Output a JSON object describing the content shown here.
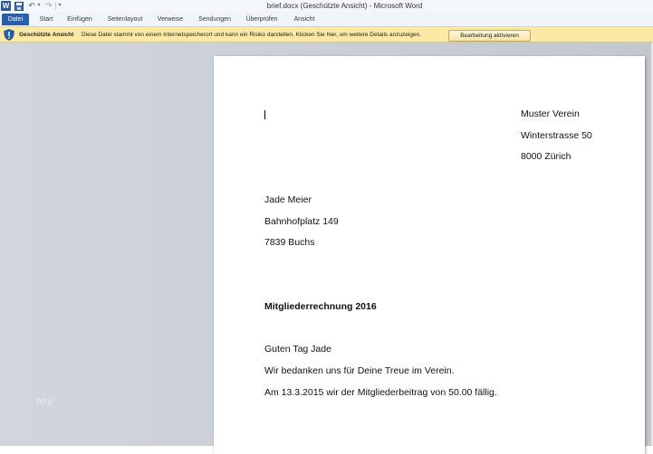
{
  "window": {
    "title": "brief.docx (Geschützte Ansicht)  -  Microsoft Word"
  },
  "quick_access": {
    "icons": [
      "word-app-icon",
      "save-icon",
      "undo-icon",
      "redo-icon",
      "customize-icon"
    ],
    "word_glyph": "W",
    "undo_glyph": "↶",
    "redo_glyph": "↷",
    "dropdown_glyph": "▾"
  },
  "ribbon": {
    "tabs": [
      {
        "label": "Datei"
      },
      {
        "label": "Start"
      },
      {
        "label": "Einfügen"
      },
      {
        "label": "Seitenlayout"
      },
      {
        "label": "Verweise"
      },
      {
        "label": "Sendungen"
      },
      {
        "label": "Überprüfen"
      },
      {
        "label": "Ansicht"
      }
    ],
    "accent": "#2a5ea8"
  },
  "message_bar": {
    "title": "Geschützte Ansicht",
    "text": "Diese Datei stammt von einem Internetspeicherort und kann ein Risiko darstellen. Klicken Sie hier, um weitere Details anzuzeigen.",
    "button": "Bearbeitung aktivieren",
    "color": "#fbe9a4"
  },
  "document": {
    "sender": [
      "Muster Verein",
      "Winterstrasse 50",
      "8000 Zürich"
    ],
    "recipient": [
      "Jade Meier",
      "Bahnhofplatz 149",
      "7839 Buchs"
    ],
    "subject": "Mitgliederrechnung 2016",
    "body": [
      "Guten Tag Jade",
      "Wir bedanken uns für Deine Treue im Verein.",
      "Am 13.3.2015 wir der Mitgliederbeitrag von 50.00 fällig."
    ]
  },
  "watermark": "http"
}
